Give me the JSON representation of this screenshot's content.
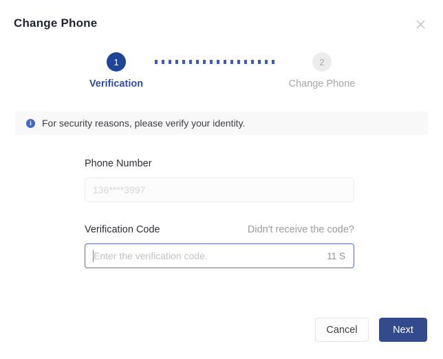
{
  "dialog": {
    "title": "Change Phone",
    "close_icon": "close-icon"
  },
  "stepper": {
    "steps": [
      {
        "number": "1",
        "label": "Verification",
        "state": "active"
      },
      {
        "number": "2",
        "label": "Change Phone",
        "state": "inactive"
      }
    ],
    "active_color": "#1f4596",
    "inactive_color": "#ececec",
    "connector_color": "#3a5bb8"
  },
  "banner": {
    "icon": "info-circle-icon",
    "message": "For security reasons, please verify your identity.",
    "background": "#f8f8f9",
    "icon_color": "#4267c4"
  },
  "form": {
    "phone": {
      "label": "Phone Number",
      "value": "136****3997",
      "disabled": true
    },
    "verification_code": {
      "label": "Verification Code",
      "resend_label": "Didn't receive the code?",
      "placeholder": "Enter the verification code.",
      "value": "",
      "countdown": "11 S",
      "focused": true
    }
  },
  "footer": {
    "cancel_label": "Cancel",
    "next_label": "Next",
    "primary_color": "#334b8d"
  }
}
